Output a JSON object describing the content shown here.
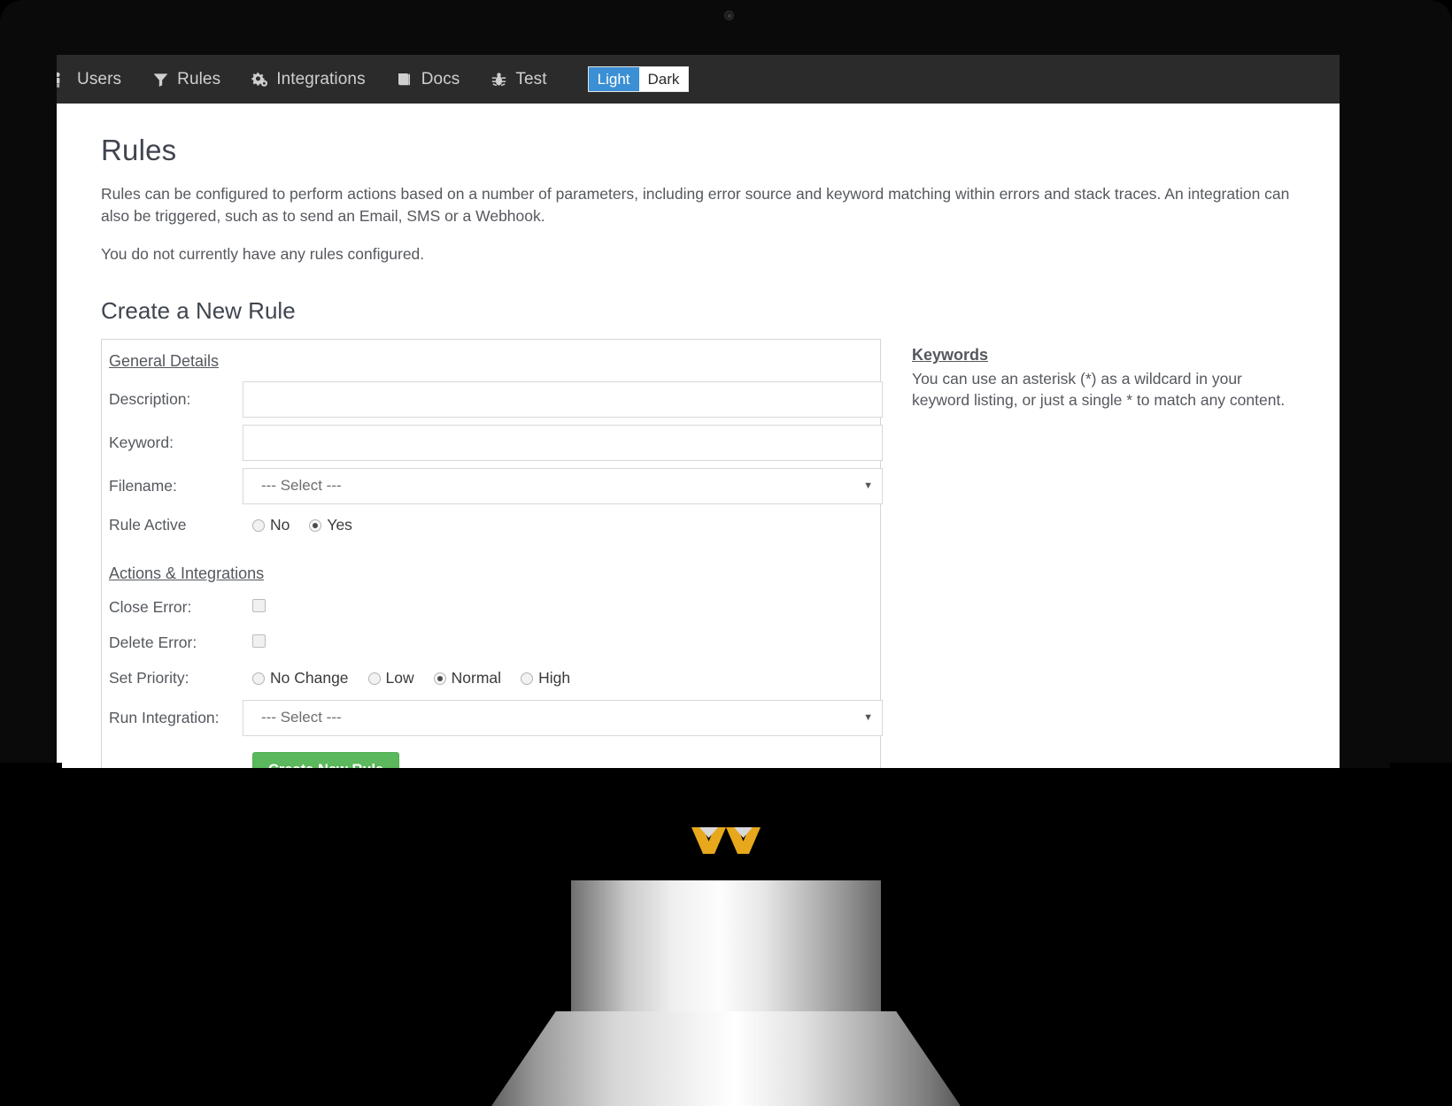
{
  "navbar": {
    "items": [
      {
        "label": "Users",
        "icon": "users-icon"
      },
      {
        "label": "Rules",
        "icon": "filter-icon"
      },
      {
        "label": "Integrations",
        "icon": "gears-icon"
      },
      {
        "label": "Docs",
        "icon": "book-icon"
      },
      {
        "label": "Test",
        "icon": "bug-icon"
      }
    ],
    "theme_toggle": {
      "light_label": "Light",
      "dark_label": "Dark",
      "active": "Light",
      "active_color": "#3b8fd4"
    }
  },
  "page": {
    "title": "Rules",
    "intro": "Rules can be configured to perform actions based on a number of parameters, including error source and keyword matching within errors and stack traces. An integration can also be triggered, such as to send an Email, SMS or a Webhook.",
    "empty_state": "You do not currently have any rules configured.",
    "section_title": "Create a New Rule"
  },
  "form": {
    "legend_general": "General Details",
    "legend_actions": "Actions & Integrations",
    "description": {
      "label": "Description:",
      "value": "",
      "placeholder": ""
    },
    "keyword": {
      "label": "Keyword:",
      "value": "",
      "placeholder": ""
    },
    "filename": {
      "label": "Filename:",
      "selected": "--- Select ---",
      "options": [
        "--- Select ---"
      ]
    },
    "rule_active": {
      "label": "Rule Active",
      "options": [
        {
          "label": "No",
          "checked": false
        },
        {
          "label": "Yes",
          "checked": true
        }
      ]
    },
    "close_error": {
      "label": "Close Error:",
      "checked": false
    },
    "delete_error": {
      "label": "Delete Error:",
      "checked": false
    },
    "set_priority": {
      "label": "Set Priority:",
      "options": [
        {
          "label": "No Change",
          "checked": false
        },
        {
          "label": "Low",
          "checked": false
        },
        {
          "label": "Normal",
          "checked": true
        },
        {
          "label": "High",
          "checked": false
        }
      ]
    },
    "run_integration": {
      "label": "Run Integration:",
      "selected": "--- Select ---",
      "options": [
        "--- Select ---"
      ]
    },
    "submit_label": "Create New Rule",
    "submit_color": "#5cb85c"
  },
  "help": {
    "title": "Keywords",
    "body": "You can use an asterisk (*) as a wildcard in your keyword listing, or just a single * to match any content."
  },
  "device": {
    "logo_color": "#e8a81c",
    "bezel_color": "#000000"
  }
}
